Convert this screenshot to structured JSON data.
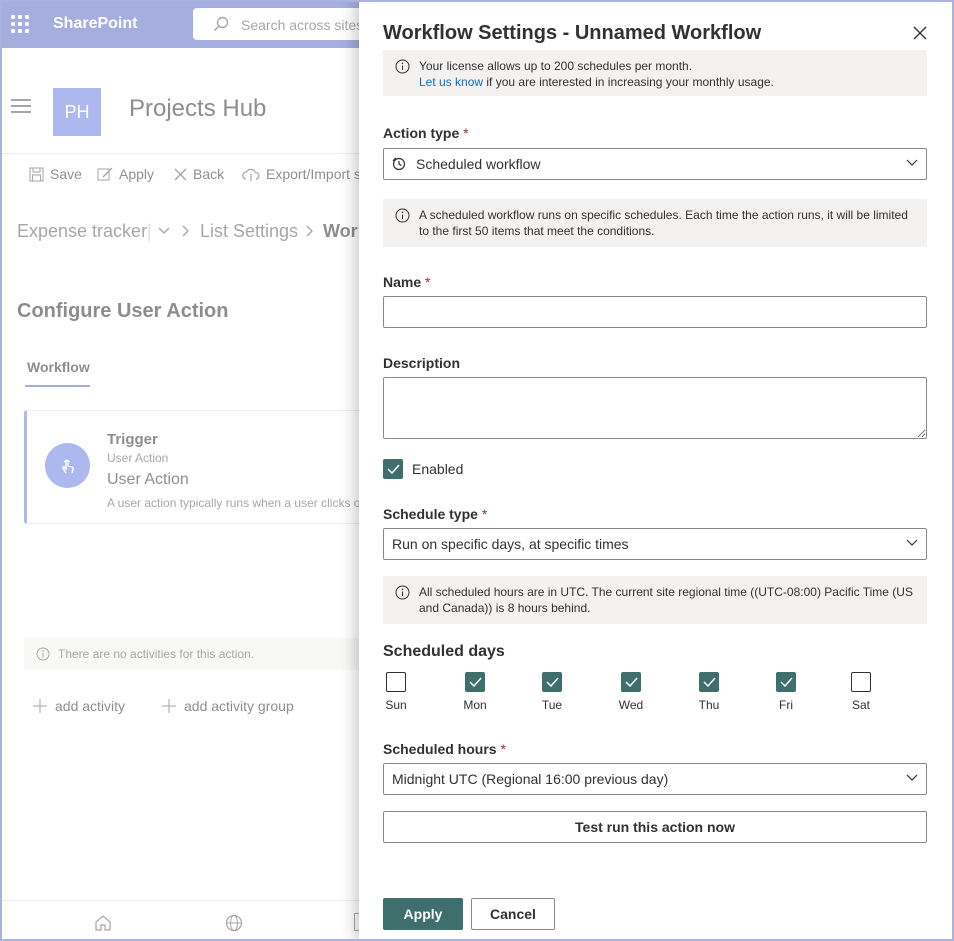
{
  "suitebar": {
    "app_name": "SharePoint",
    "search_placeholder": "Search across sites"
  },
  "site": {
    "logo_initials": "PH",
    "title": "Projects Hub"
  },
  "commandbar": {
    "save": "Save",
    "apply": "Apply",
    "back": "Back",
    "export": "Export/Import s"
  },
  "breadcrumb": {
    "list": "Expense tracker",
    "settings": "List Settings",
    "current": "Wor"
  },
  "configure": {
    "title": "Configure User Action",
    "tab": "Workflow",
    "trigger_title": "Trigger",
    "trigger_sub": "User Action",
    "trigger_name": "User Action",
    "trigger_desc": "A user action typically runs when a user clicks on",
    "no_activities": "There are no activities for this action.",
    "add_activity": "add activity",
    "add_activity_group": "add activity group"
  },
  "panel": {
    "title": "Workflow Settings - Unnamed Workflow",
    "license_line1": "Your license allows up to 200 schedules per month.",
    "license_link": "Let us know",
    "license_line2": " if you are interested in increasing your monthly usage.",
    "action_type_label": "Action type",
    "action_type_value": "Scheduled workflow",
    "action_info": "A scheduled workflow runs on specific schedules. Each time the action runs, it will be limited to the first 50 items that meet the conditions.",
    "name_label": "Name",
    "name_value": "",
    "description_label": "Description",
    "description_value": "",
    "enabled_label": "Enabled",
    "schedule_type_label": "Schedule type",
    "schedule_type_value": "Run on specific days, at specific times",
    "schedule_info": "All scheduled hours are in UTC. The current site regional time ((UTC-08:00) Pacific Time (US and Canada)) is 8 hours behind.",
    "scheduled_days_label": "Scheduled days",
    "days": [
      {
        "label": "Sun",
        "checked": false
      },
      {
        "label": "Mon",
        "checked": true
      },
      {
        "label": "Tue",
        "checked": true
      },
      {
        "label": "Wed",
        "checked": true
      },
      {
        "label": "Thu",
        "checked": true
      },
      {
        "label": "Fri",
        "checked": true
      },
      {
        "label": "Sat",
        "checked": false
      }
    ],
    "scheduled_hours_label": "Scheduled hours",
    "scheduled_hours_value": "Midnight UTC (Regional 16:00 previous day)",
    "test_run": "Test run this action now",
    "apply": "Apply",
    "cancel": "Cancel",
    "required_mark": "*"
  },
  "colors": {
    "suitebar": "#5b6cc4",
    "accent": "#3f6f6d",
    "required": "#a4262c",
    "link": "#0f6cbd"
  }
}
